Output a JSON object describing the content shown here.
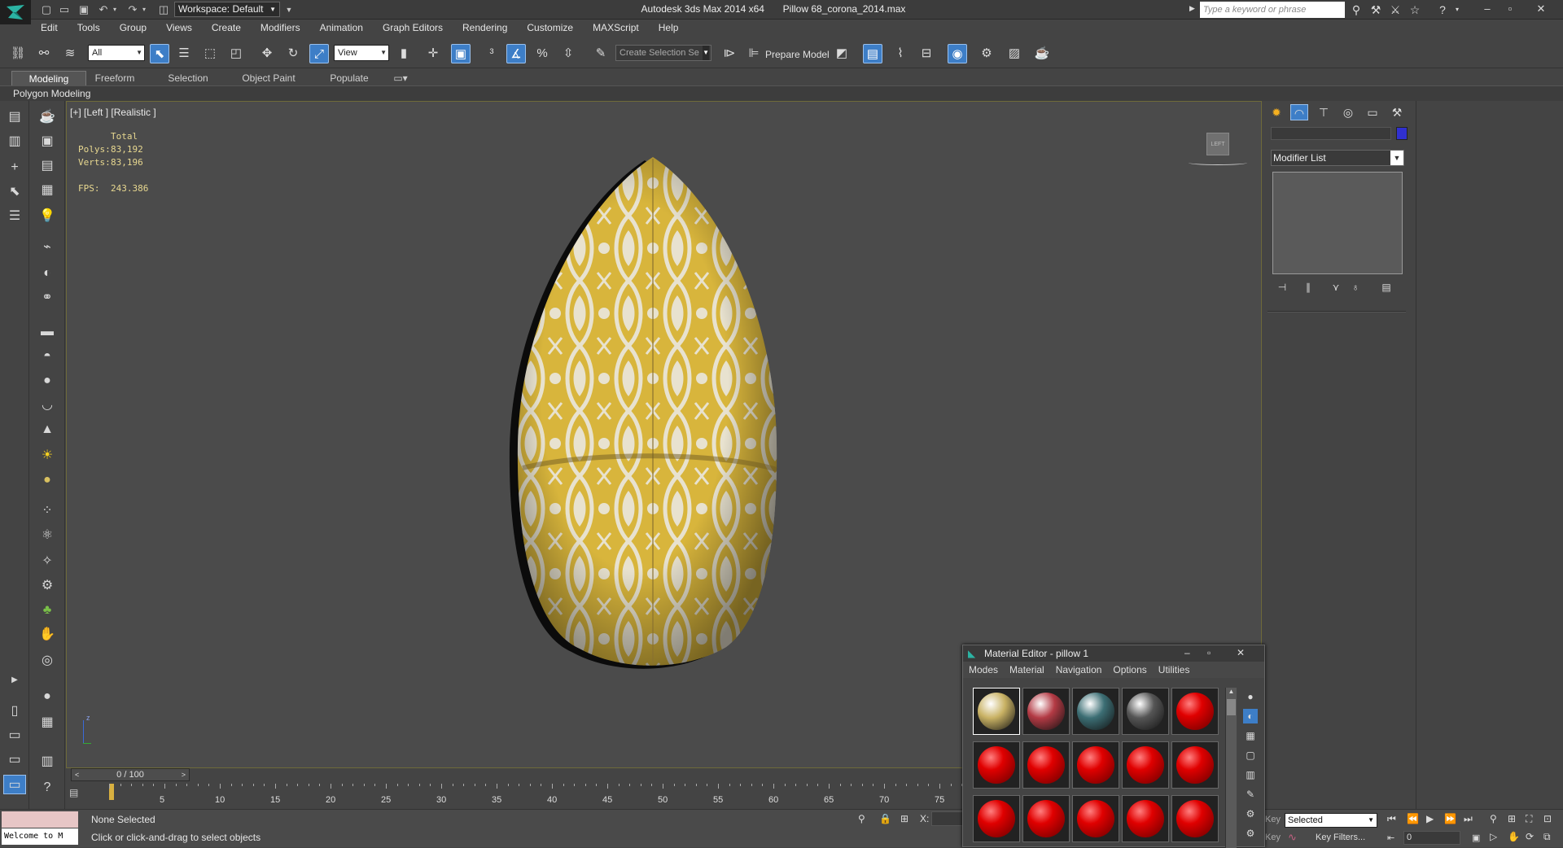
{
  "window": {
    "title": "Autodesk 3ds Max  2014 x64",
    "file": "Pillow 68_corona_2014.max",
    "workspace": "Workspace: Default",
    "search_placeholder": "Type a keyword or phrase"
  },
  "menu": [
    "Edit",
    "Tools",
    "Group",
    "Views",
    "Create",
    "Modifiers",
    "Animation",
    "Graph Editors",
    "Rendering",
    "Customize",
    "MAXScript",
    "Help"
  ],
  "toolbar": {
    "selection_filter": "All",
    "coord_system": "View",
    "named_selection": "Create Selection Se",
    "prepare_model": "Prepare Model"
  },
  "ribbon": {
    "tabs": [
      "Modeling",
      "Freeform",
      "Selection",
      "Object Paint",
      "Populate"
    ],
    "active_tab": "Modeling",
    "panel": "Polygon Modeling"
  },
  "viewport": {
    "label": "[+] [Left ] [Realistic ]",
    "stats": {
      "total_label": "Total",
      "polys_label": "Polys:",
      "polys": "83,192",
      "verts_label": "Verts:",
      "verts": "83,196",
      "fps_label": "FPS:",
      "fps": "243.386"
    },
    "viewcube_label": "LEFT",
    "axis_z": "z"
  },
  "command_panel": {
    "modifier_list": "Modifier List"
  },
  "timeline": {
    "frame": "0 / 100",
    "ticks": [
      "0",
      "5",
      "10",
      "15",
      "20",
      "25",
      "30",
      "35",
      "40",
      "45",
      "50",
      "55",
      "60",
      "65",
      "70",
      "75"
    ]
  },
  "status": {
    "selection": "None Selected",
    "prompt": "Click or click-and-drag to select objects",
    "maxscript": "Welcome to M",
    "coord_x": "X:",
    "key_label": "Key",
    "key_mode": "Selected",
    "key_filters": "Key Filters...",
    "frame_field": "0"
  },
  "material_editor": {
    "title": "Material Editor - pillow 1",
    "menu": [
      "Modes",
      "Material",
      "Navigation",
      "Options",
      "Utilities"
    ],
    "slots": [
      {
        "color": "#c9b264",
        "kind": "yellow"
      },
      {
        "color": "#b33a44",
        "kind": "red-pattern"
      },
      {
        "color": "#3c6e74",
        "kind": "teal-pattern"
      },
      {
        "color": "#555555",
        "kind": "gray-pattern"
      },
      {
        "color": "#e00000",
        "kind": "default"
      },
      {
        "color": "#e00000",
        "kind": "default"
      },
      {
        "color": "#e00000",
        "kind": "default"
      },
      {
        "color": "#e00000",
        "kind": "default"
      },
      {
        "color": "#e00000",
        "kind": "default"
      },
      {
        "color": "#e00000",
        "kind": "default"
      },
      {
        "color": "#e00000",
        "kind": "default"
      },
      {
        "color": "#e00000",
        "kind": "default"
      },
      {
        "color": "#e00000",
        "kind": "default"
      },
      {
        "color": "#e00000",
        "kind": "default"
      },
      {
        "color": "#e00000",
        "kind": "default"
      }
    ]
  },
  "colors": {
    "accent": "#3d7ec7",
    "viewport_bg": "#4b4b4b",
    "pillow_yellow": "#d8b53c",
    "pillow_pattern": "#e8e2cf",
    "stats_text": "#e8d890",
    "default_material_red": "#e00000"
  }
}
